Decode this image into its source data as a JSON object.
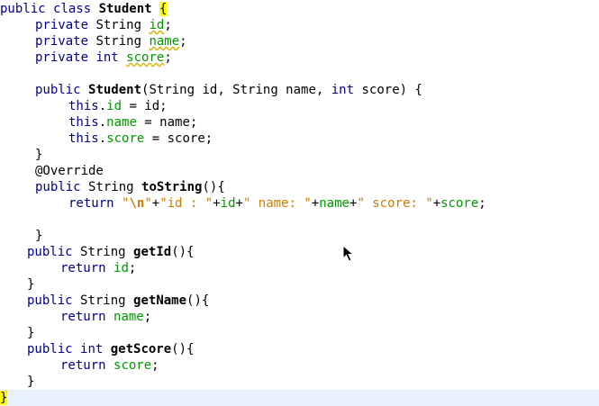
{
  "editor": {
    "lines": [
      {
        "indent": 0,
        "tokens": [
          {
            "t": "public class ",
            "c": "keyword"
          },
          {
            "t": "Student",
            "c": "plain bold"
          },
          {
            "t": " ",
            "c": "plain"
          },
          {
            "t": "{",
            "c": "plain match"
          }
        ]
      },
      {
        "indent": 39,
        "tokens": [
          {
            "t": "private ",
            "c": "keyword"
          },
          {
            "t": "String ",
            "c": "plain"
          },
          {
            "t": "id",
            "c": "field wavy"
          },
          {
            "t": ";",
            "c": "plain"
          }
        ]
      },
      {
        "indent": 39,
        "tokens": [
          {
            "t": "private ",
            "c": "keyword"
          },
          {
            "t": "String ",
            "c": "plain"
          },
          {
            "t": "name",
            "c": "field wavy"
          },
          {
            "t": ";",
            "c": "plain"
          }
        ]
      },
      {
        "indent": 39,
        "tokens": [
          {
            "t": "private ",
            "c": "keyword"
          },
          {
            "t": "int ",
            "c": "keyword"
          },
          {
            "t": "score",
            "c": "field wavy"
          },
          {
            "t": ";",
            "c": "plain"
          }
        ]
      },
      {
        "indent": 0,
        "tokens": []
      },
      {
        "indent": 39,
        "tokens": [
          {
            "t": "public ",
            "c": "keyword"
          },
          {
            "t": "Student",
            "c": "plain bold"
          },
          {
            "t": "(String id, String name, ",
            "c": "plain"
          },
          {
            "t": "int",
            "c": "keyword"
          },
          {
            "t": " score) {",
            "c": "plain"
          }
        ]
      },
      {
        "indent": 76,
        "tokens": [
          {
            "t": "this",
            "c": "keyword"
          },
          {
            "t": ".",
            "c": "plain"
          },
          {
            "t": "id",
            "c": "field"
          },
          {
            "t": " = id;",
            "c": "plain"
          }
        ]
      },
      {
        "indent": 76,
        "tokens": [
          {
            "t": "this",
            "c": "keyword"
          },
          {
            "t": ".",
            "c": "plain"
          },
          {
            "t": "name",
            "c": "field"
          },
          {
            "t": " = name;",
            "c": "plain"
          }
        ]
      },
      {
        "indent": 76,
        "tokens": [
          {
            "t": "this",
            "c": "keyword"
          },
          {
            "t": ".",
            "c": "plain"
          },
          {
            "t": "score",
            "c": "field"
          },
          {
            "t": " = score;",
            "c": "plain"
          }
        ]
      },
      {
        "indent": 39,
        "tokens": [
          {
            "t": "}",
            "c": "plain"
          }
        ]
      },
      {
        "indent": 39,
        "tokens": [
          {
            "t": "@Override",
            "c": "plain"
          }
        ]
      },
      {
        "indent": 39,
        "tokens": [
          {
            "t": "public ",
            "c": "keyword"
          },
          {
            "t": "String ",
            "c": "plain"
          },
          {
            "t": "toString",
            "c": "plain bold"
          },
          {
            "t": "(){",
            "c": "plain"
          }
        ]
      },
      {
        "indent": 76,
        "tokens": [
          {
            "t": "return ",
            "c": "keyword"
          },
          {
            "t": "\"",
            "c": "string"
          },
          {
            "t": "\\n",
            "c": "string bold"
          },
          {
            "t": "\"",
            "c": "string"
          },
          {
            "t": "+",
            "c": "plain"
          },
          {
            "t": "\"id : \"",
            "c": "string"
          },
          {
            "t": "+",
            "c": "plain"
          },
          {
            "t": "id",
            "c": "field"
          },
          {
            "t": "+",
            "c": "plain"
          },
          {
            "t": "\" name: \"",
            "c": "string"
          },
          {
            "t": "+",
            "c": "plain"
          },
          {
            "t": "name",
            "c": "field"
          },
          {
            "t": "+",
            "c": "plain"
          },
          {
            "t": "\" score: \"",
            "c": "string"
          },
          {
            "t": "+",
            "c": "plain"
          },
          {
            "t": "score",
            "c": "field"
          },
          {
            "t": ";",
            "c": "plain"
          }
        ]
      },
      {
        "indent": 0,
        "tokens": []
      },
      {
        "indent": 39,
        "tokens": [
          {
            "t": "}",
            "c": "plain"
          }
        ]
      },
      {
        "indent": 30,
        "tokens": [
          {
            "t": "public ",
            "c": "keyword"
          },
          {
            "t": "String ",
            "c": "plain"
          },
          {
            "t": "getId",
            "c": "plain bold"
          },
          {
            "t": "(){",
            "c": "plain"
          }
        ]
      },
      {
        "indent": 67,
        "tokens": [
          {
            "t": "return ",
            "c": "keyword"
          },
          {
            "t": "id",
            "c": "field"
          },
          {
            "t": ";",
            "c": "plain"
          }
        ]
      },
      {
        "indent": 30,
        "tokens": [
          {
            "t": "}",
            "c": "plain"
          }
        ]
      },
      {
        "indent": 30,
        "tokens": [
          {
            "t": "public ",
            "c": "keyword"
          },
          {
            "t": "String ",
            "c": "plain"
          },
          {
            "t": "getName",
            "c": "plain bold"
          },
          {
            "t": "(){",
            "c": "plain"
          }
        ]
      },
      {
        "indent": 67,
        "tokens": [
          {
            "t": "return ",
            "c": "keyword"
          },
          {
            "t": "name",
            "c": "field"
          },
          {
            "t": ";",
            "c": "plain"
          }
        ]
      },
      {
        "indent": 30,
        "tokens": [
          {
            "t": "}",
            "c": "plain"
          }
        ]
      },
      {
        "indent": 30,
        "tokens": [
          {
            "t": "public ",
            "c": "keyword"
          },
          {
            "t": "int ",
            "c": "keyword"
          },
          {
            "t": "getScore",
            "c": "plain bold"
          },
          {
            "t": "(){",
            "c": "plain"
          }
        ]
      },
      {
        "indent": 67,
        "tokens": [
          {
            "t": "return ",
            "c": "keyword"
          },
          {
            "t": "score",
            "c": "field"
          },
          {
            "t": ";",
            "c": "plain"
          }
        ]
      },
      {
        "indent": 30,
        "tokens": [
          {
            "t": "}",
            "c": "plain"
          }
        ]
      },
      {
        "indent": 0,
        "current": true,
        "tokens": [
          {
            "t": "}",
            "c": "plain match"
          }
        ]
      }
    ]
  },
  "colors": {
    "keyword": "#00008b",
    "field": "#009900",
    "string": "#ce7b00",
    "bracket_match": "#ffff00",
    "current_line": "#e8f2fe"
  },
  "cursor": {
    "icon": "mouse-pointer-icon"
  }
}
